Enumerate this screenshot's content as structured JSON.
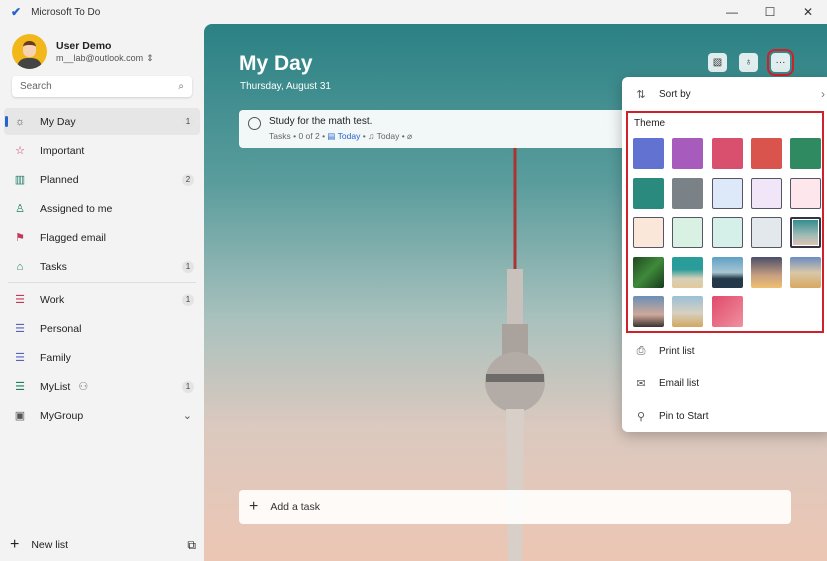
{
  "window": {
    "title": "Microsoft To Do",
    "controls": [
      "—",
      "☐",
      "✕"
    ]
  },
  "user": {
    "name": "User Demo",
    "email": "m__lab@outlook.com"
  },
  "search": {
    "placeholder": "Search"
  },
  "sidebar": {
    "items": [
      {
        "label": "My Day",
        "icon": "sun-icon",
        "glyph": "☼",
        "count": "1",
        "active": true
      },
      {
        "label": "Important",
        "icon": "star-icon",
        "glyph": "☆",
        "count": ""
      },
      {
        "label": "Planned",
        "icon": "calendar-icon",
        "glyph": "▥",
        "count": "2"
      },
      {
        "label": "Assigned to me",
        "icon": "person-icon",
        "glyph": "♙",
        "count": ""
      },
      {
        "label": "Flagged email",
        "icon": "flag-icon",
        "glyph": "⚑",
        "count": ""
      },
      {
        "label": "Tasks",
        "icon": "home-icon",
        "glyph": "⌂",
        "count": "1"
      },
      {
        "label": "Work",
        "icon": "list-icon",
        "glyph": "☰",
        "count": "1"
      },
      {
        "label": "Personal",
        "icon": "list-icon",
        "glyph": "☰",
        "count": ""
      },
      {
        "label": "Family",
        "icon": "list-icon",
        "glyph": "☰",
        "count": ""
      },
      {
        "label": "MyList",
        "icon": "list-icon",
        "glyph": "☰",
        "count": "1"
      },
      {
        "label": "MyGroup",
        "icon": "group-icon",
        "glyph": "▣",
        "count": ""
      }
    ],
    "new_list": "New list"
  },
  "main": {
    "title": "My Day",
    "date": "Thursday, August 31",
    "add_task": "Add a task",
    "task": {
      "title": "Study for the math test.",
      "list": "Tasks",
      "steps": "0 of 2",
      "due": "Today",
      "reminder": "Today"
    }
  },
  "menu": {
    "sort_by": "Sort by",
    "theme": "Theme",
    "print": "Print list",
    "email": "Email list",
    "pin": "Pin to Start",
    "swatches": [
      "#6272d0",
      "#a65bbd",
      "#d9506f",
      "#d9544d",
      "#2f8a62",
      "#2a8a7e",
      "#7a8288",
      "#dde9f8",
      "#f1e6f8",
      "#fde6ec",
      "#fbe6da",
      "#d8f1e2",
      "#d4f0e8",
      "#e3e8ec",
      "tower",
      "palm",
      "beach",
      "lake",
      "sunset",
      "desert",
      "lighthouse",
      "poppy",
      "pink"
    ],
    "selected_theme": "tower"
  }
}
